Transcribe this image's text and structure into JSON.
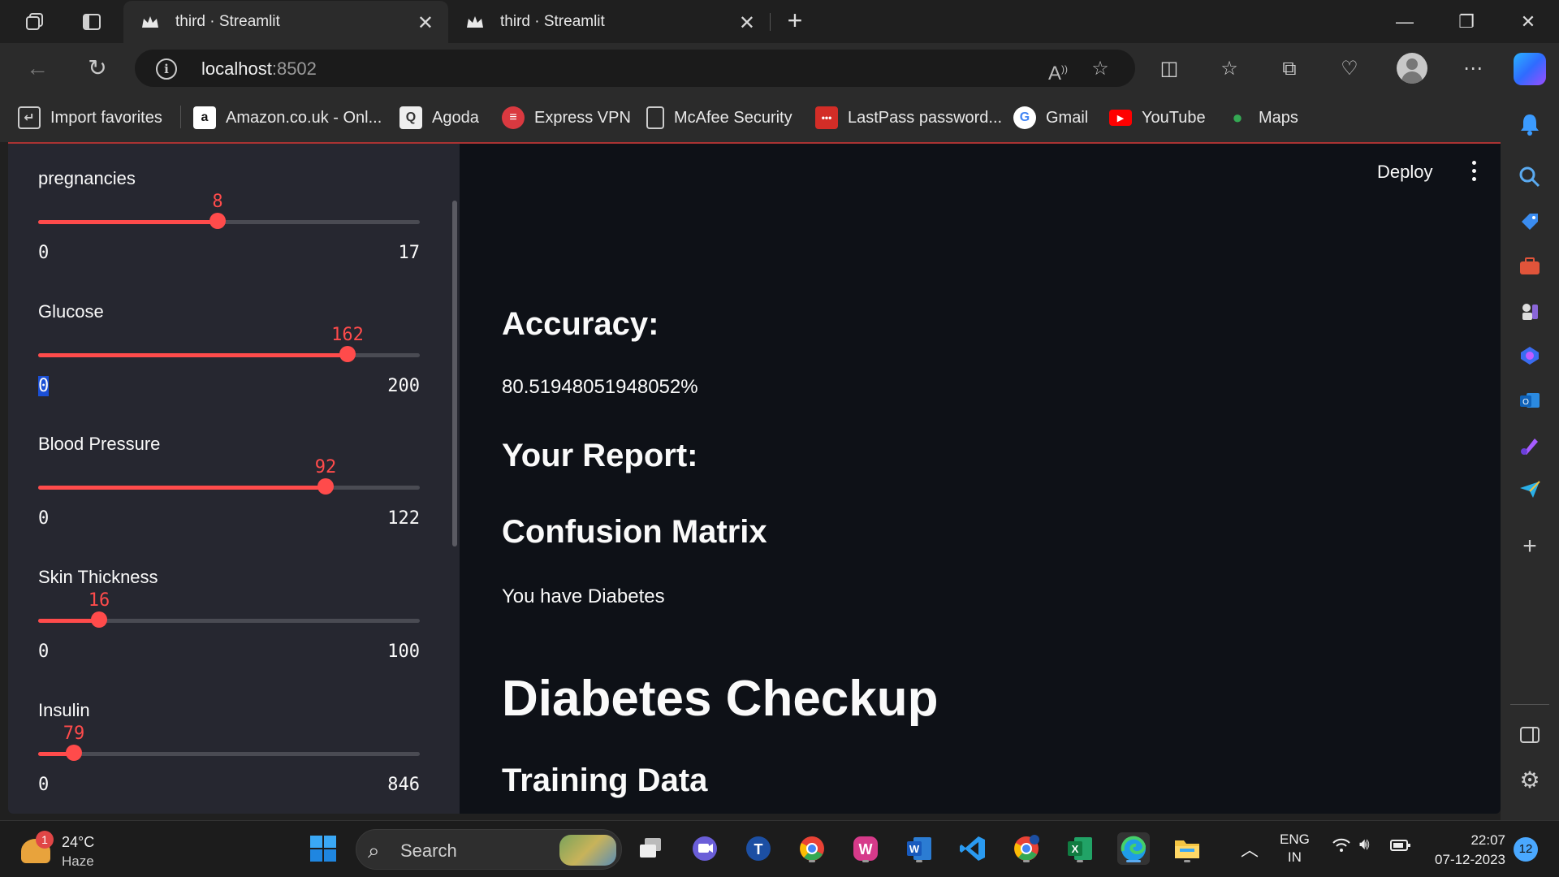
{
  "browser": {
    "tabs": [
      {
        "title": "third · Streamlit",
        "active": true
      },
      {
        "title": "third · Streamlit",
        "active": false
      }
    ],
    "address": {
      "host": "localhost",
      "port": ":8502"
    },
    "favorites": [
      {
        "label": "Import favorites",
        "icon": "import-icon"
      },
      {
        "label": "Amazon.co.uk - Onl...",
        "icon": "amazon-icon"
      },
      {
        "label": "Agoda",
        "icon": "agoda-icon"
      },
      {
        "label": "Express VPN",
        "icon": "expressvpn-icon"
      },
      {
        "label": "McAfee Security",
        "icon": "page-icon"
      },
      {
        "label": "LastPass password...",
        "icon": "lastpass-icon"
      },
      {
        "label": "Gmail",
        "icon": "google-icon"
      },
      {
        "label": "YouTube",
        "icon": "youtube-icon"
      },
      {
        "label": "Maps",
        "icon": "maps-icon"
      }
    ]
  },
  "sidebar": {
    "sliders": [
      {
        "label": "pregnancies",
        "value": 8,
        "min": 0,
        "max": 17
      },
      {
        "label": "Glucose",
        "value": 162,
        "min": 0,
        "max": 200
      },
      {
        "label": "Blood Pressure",
        "value": 92,
        "min": 0,
        "max": 122
      },
      {
        "label": "Skin Thickness",
        "value": 16,
        "min": 0,
        "max": 100
      },
      {
        "label": "Insulin",
        "value": 79,
        "min": 0,
        "max": 846
      }
    ]
  },
  "main": {
    "deploy_label": "Deploy",
    "accuracy_heading": "Accuracy:",
    "accuracy_value": "80.51948051948052%",
    "report_heading": "Your Report:",
    "confusion_heading": "Confusion Matrix",
    "result_text": "You have Diabetes",
    "title": "Diabetes Checkup",
    "training_heading": "Training Data"
  },
  "taskbar": {
    "weather": {
      "temp": "24°C",
      "condition": "Haze",
      "badge": "1"
    },
    "search_label": "Search",
    "language": {
      "line1": "ENG",
      "line2": "IN"
    },
    "time": "22:07",
    "date": "07-12-2023",
    "notifications": "12"
  },
  "colors": {
    "accent": "#ff4b4b",
    "sidebar_bg": "#262730",
    "main_bg": "#0e1117"
  }
}
